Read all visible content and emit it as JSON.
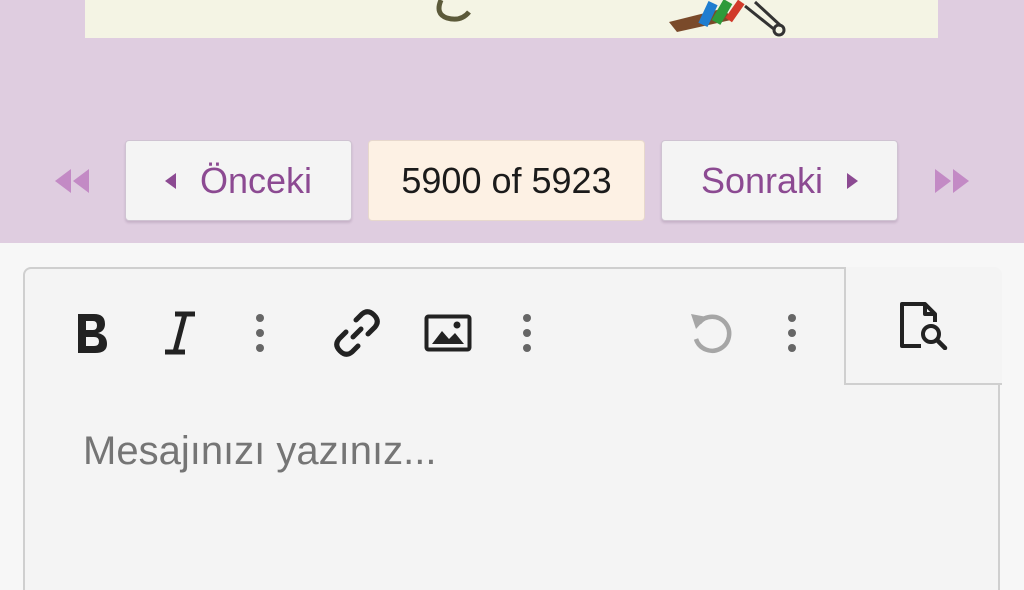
{
  "pagination": {
    "first_icon": "double-chevron-left-icon",
    "prev_label": "Önceki",
    "current": "5900 of 5923",
    "next_label": "Sonraki",
    "last_icon": "double-chevron-right-icon"
  },
  "editor": {
    "toolbar": [
      {
        "name": "bold-icon",
        "glyph": "B"
      },
      {
        "name": "italic-icon",
        "glyph": "I"
      },
      {
        "name": "more-text-options-icon"
      },
      {
        "name": "link-icon"
      },
      {
        "name": "image-icon"
      },
      {
        "name": "more-insert-options-icon"
      },
      {
        "name": "undo-icon"
      },
      {
        "name": "more-options-icon"
      },
      {
        "name": "preview-icon"
      }
    ],
    "placeholder": "Mesajınızı yazınız..."
  },
  "colors": {
    "band": "#dfcde0",
    "accent": "#8c4a92",
    "current_page_bg": "#fdf1e4",
    "editor_bg": "#f4f4f4"
  }
}
